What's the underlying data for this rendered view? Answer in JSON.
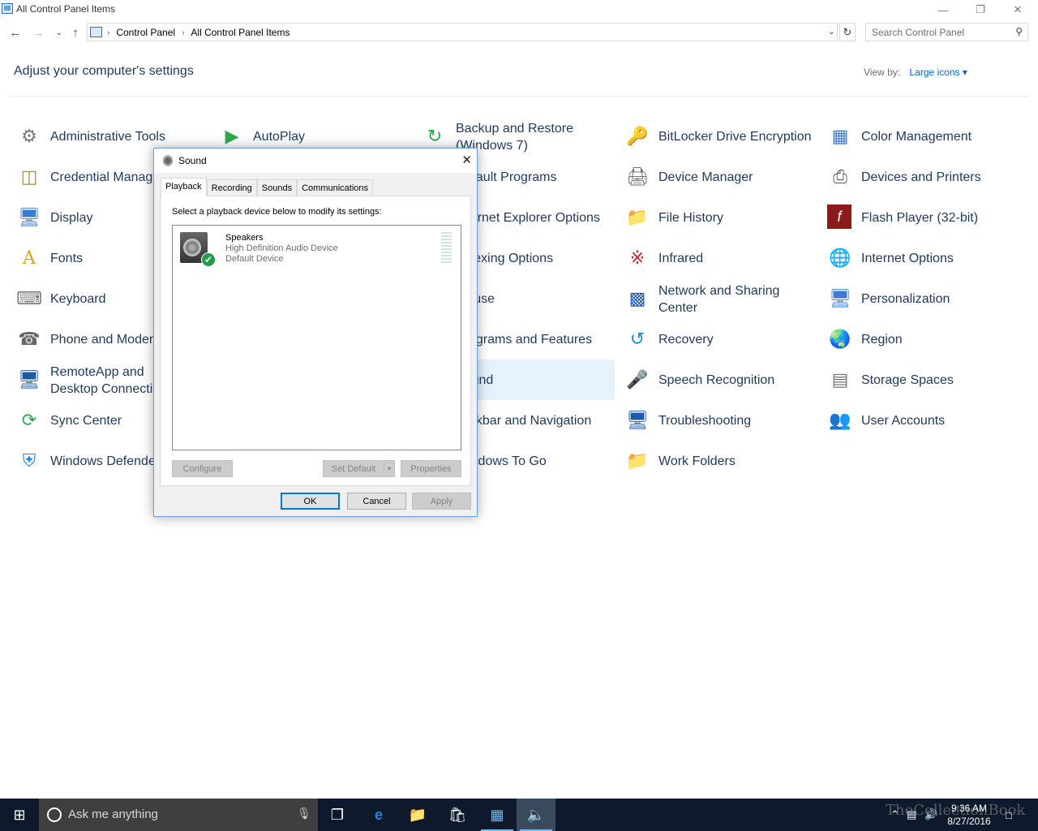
{
  "window": {
    "title": "All Control Panel Items",
    "minimize_glyph": "—",
    "restore_glyph": "❐",
    "close_glyph": "✕"
  },
  "address": {
    "breadcrumbs": [
      "Control Panel",
      "All Control Panel Items"
    ],
    "search_placeholder": "Search Control Panel"
  },
  "header": {
    "title": "Adjust your computer's settings",
    "view_by_label": "View by:",
    "view_by_value": "Large icons"
  },
  "items": [
    {
      "label": "Administrative Tools",
      "icon": "admin-tools-icon"
    },
    {
      "label": "AutoPlay",
      "icon": "autoplay-icon"
    },
    {
      "label": "Backup and Restore (Windows 7)",
      "icon": "backup-icon"
    },
    {
      "label": "BitLocker Drive Encryption",
      "icon": "bitlocker-icon"
    },
    {
      "label": "Color Management",
      "icon": "color-management-icon"
    },
    {
      "label": "Credential Manager",
      "icon": "credential-manager-icon"
    },
    {
      "label": "Default Programs",
      "icon": "default-programs-icon"
    },
    {
      "label": "Device Manager",
      "icon": "device-manager-icon"
    },
    {
      "label": "Devices and Printers",
      "icon": "devices-printers-icon"
    },
    {
      "label": "Display",
      "icon": "display-icon"
    },
    {
      "label": "Internet Explorer Options",
      "icon": "ie-options-icon"
    },
    {
      "label": "File History",
      "icon": "file-history-icon"
    },
    {
      "label": "Flash Player (32-bit)",
      "icon": "flash-player-icon"
    },
    {
      "label": "Fonts",
      "icon": "fonts-icon"
    },
    {
      "label": "Indexing Options",
      "icon": "indexing-icon"
    },
    {
      "label": "Infrared",
      "icon": "infrared-icon"
    },
    {
      "label": "Internet Options",
      "icon": "internet-options-icon"
    },
    {
      "label": "Keyboard",
      "icon": "keyboard-icon"
    },
    {
      "label": "Mouse",
      "icon": "mouse-icon"
    },
    {
      "label": "Network and Sharing Center",
      "icon": "network-icon"
    },
    {
      "label": "Personalization",
      "icon": "personalization-icon"
    },
    {
      "label": "Phone and Modem",
      "icon": "phone-modem-icon"
    },
    {
      "label": "Programs and Features",
      "icon": "programs-icon"
    },
    {
      "label": "Recovery",
      "icon": "recovery-icon"
    },
    {
      "label": "Region",
      "icon": "region-icon"
    },
    {
      "label": "RemoteApp and Desktop Connections",
      "icon": "remoteapp-icon"
    },
    {
      "label": "Sound",
      "icon": "sound-icon"
    },
    {
      "label": "Speech Recognition",
      "icon": "speech-icon"
    },
    {
      "label": "Storage Spaces",
      "icon": "storage-spaces-icon"
    },
    {
      "label": "Sync Center",
      "icon": "sync-center-icon"
    },
    {
      "label": "Taskbar and Navigation",
      "icon": "taskbar-icon"
    },
    {
      "label": "Troubleshooting",
      "icon": "troubleshooting-icon"
    },
    {
      "label": "User Accounts",
      "icon": "user-accounts-icon"
    },
    {
      "label": "Windows Defender",
      "icon": "defender-icon"
    },
    {
      "label": "Windows To Go",
      "icon": "windows-to-go-icon"
    },
    {
      "label": "Work Folders",
      "icon": "work-folders-icon"
    }
  ],
  "dialog": {
    "title": "Sound",
    "close_glyph": "✕",
    "tabs": [
      "Playback",
      "Recording",
      "Sounds",
      "Communications"
    ],
    "instruction": "Select a playback device below to modify its settings:",
    "device": {
      "name": "Speakers",
      "description": "High Definition Audio Device",
      "status": "Default Device",
      "check_glyph": "✔"
    },
    "buttons": {
      "configure": "Configure",
      "set_default": "Set Default",
      "properties": "Properties",
      "ok": "OK",
      "cancel": "Cancel",
      "apply": "Apply"
    }
  },
  "taskbar": {
    "search_placeholder": "Ask me anything",
    "time": "9:36 AM",
    "date": "8/27/2016",
    "watermark": "TheCollectionBook"
  }
}
